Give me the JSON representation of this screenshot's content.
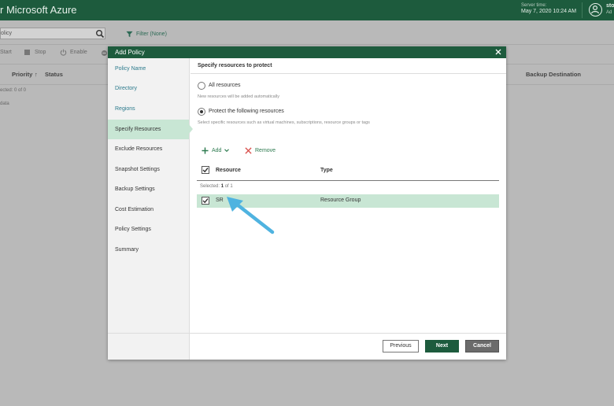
{
  "header": {
    "app_title": "r Microsoft Azure",
    "server_time_label": "Server time:",
    "server_time": "May 7, 2020 10:24 AM",
    "user_name": "sto",
    "user_role": "Ad"
  },
  "background": {
    "search_value": "olicy",
    "filter_label": "Filter (None)",
    "toolbar": {
      "start": "Start",
      "stop": "Stop",
      "enable": "Enable"
    },
    "columns": {
      "priority": "Priority",
      "sort_arrow": "↑",
      "status": "Status",
      "backup_destination": "Backup Destination"
    },
    "selected_text": "ected:  0 of 0",
    "no_data": "data"
  },
  "modal": {
    "title": "Add Policy",
    "steps": [
      "Policy Name",
      "Directory",
      "Regions",
      "Specify Resources",
      "Exclude Resources",
      "Snapshot Settings",
      "Backup Settings",
      "Cost Estimation",
      "Policy Settings",
      "Summary"
    ],
    "section_title": "Specify resources to protect",
    "options": {
      "all_resources": "All resources",
      "all_hint": "New resources will be added automatically",
      "protect_following": "Protect the following resources",
      "protect_hint": "Select specific resources such as virtual machines, subscriptions, resource groups or tags"
    },
    "actions": {
      "add": "Add",
      "remove": "Remove"
    },
    "table": {
      "headers": {
        "resource": "Resource",
        "type": "Type"
      },
      "selected_label": "Selected:",
      "selected_count": "1",
      "selected_of": "of 1",
      "rows": [
        {
          "resource": "SR",
          "type": "Resource Group"
        }
      ]
    },
    "buttons": {
      "previous": "Previous",
      "next": "Next",
      "cancel": "Cancel"
    }
  },
  "colors": {
    "header_green": "#1d5b3d",
    "selected_row": "#c8e6d4",
    "link_teal": "#2b7a8c",
    "annotation_arrow": "#4fb3e0"
  }
}
